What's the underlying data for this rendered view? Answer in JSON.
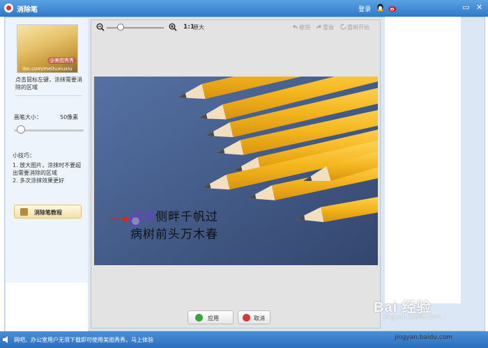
{
  "window": {
    "title": "消除笔",
    "login_label": "登录",
    "min_glyph": "▭",
    "close_glyph": "✕"
  },
  "sidebar": {
    "thumbnail": {
      "badge": "@美图秀秀",
      "url": "ibo.com/meituxiuxiu"
    },
    "hint": "点击鼠标左键，涂抹需要消除的区域",
    "brush_size_label": "画笔大小：",
    "brush_size_value": "50像素",
    "brush_size_level": 0.1,
    "tips_title": "小技巧：",
    "tips": [
      "1. 放大图片，涂抹时不要超出需要消除的区域",
      "2. 多次涂抹效果更好"
    ],
    "tutorial_button": "消除笔教程"
  },
  "toolbar": {
    "ratio": "1:1",
    "original_size": "原大",
    "undo": "撤销",
    "redo": "重做",
    "restart": "重新开始"
  },
  "canvas": {
    "poem_line1_erased": "沉舟",
    "poem_line1_rest": "侧畔千帆过",
    "poem_line2": "病树前头万木春"
  },
  "actions": {
    "apply": "应用",
    "cancel": "取消"
  },
  "status": {
    "text": "网吧、办公室用户无须下载即可使用美图秀秀，马上体验"
  },
  "watermark": {
    "logo": "Bai 经验",
    "sub": "jingyan.baidu.com",
    "url": "jingyan.baidu.com"
  },
  "colors": {
    "titlebar": "#2f78c8",
    "erase_mark": "#6b3cc7",
    "arrow": "#e0241b",
    "apply_icon": "#3aa33a",
    "cancel_icon": "#d23a3a"
  }
}
